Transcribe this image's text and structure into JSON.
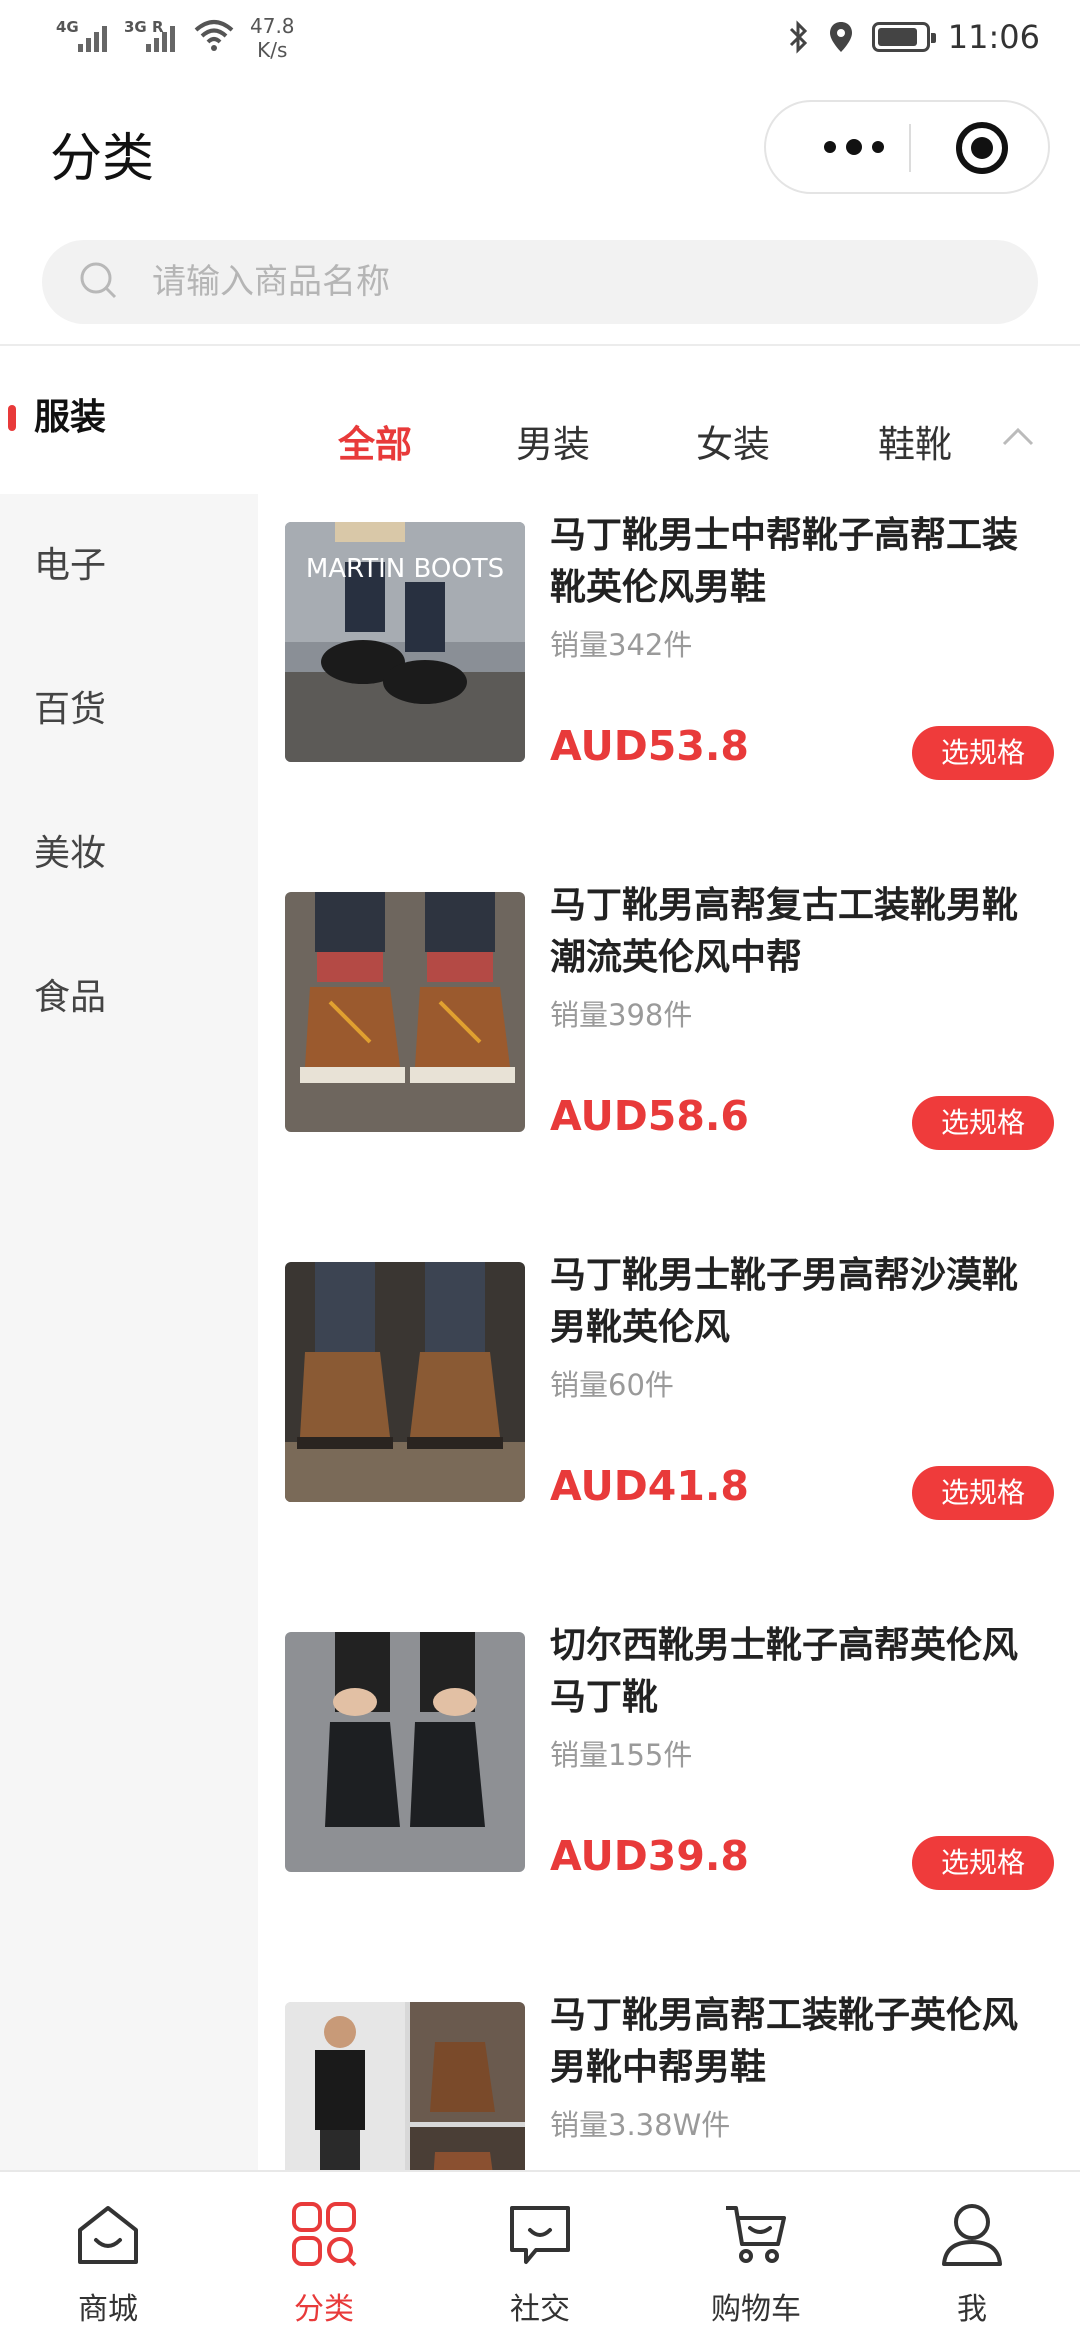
{
  "status_bar": {
    "net1": "4G",
    "net2": "3G R",
    "speed_value": "47.8",
    "speed_unit": "K/s",
    "time": "11:06",
    "battery_level": 0.85
  },
  "header": {
    "title": "分类"
  },
  "search": {
    "placeholder": "请输入商品名称",
    "value": ""
  },
  "sidebar": {
    "items": [
      {
        "label": "服装",
        "active": true
      },
      {
        "label": "电子",
        "active": false
      },
      {
        "label": "百货",
        "active": false
      },
      {
        "label": "美妆",
        "active": false
      },
      {
        "label": "食品",
        "active": false
      }
    ]
  },
  "tabs": {
    "items": [
      {
        "label": "全部",
        "active": true
      },
      {
        "label": "男装",
        "active": false
      },
      {
        "label": "女装",
        "active": false
      },
      {
        "label": "鞋靴",
        "active": false
      }
    ]
  },
  "products": [
    {
      "name": "马丁靴男士中帮靴子高帮工装靴英伦风男鞋",
      "sales": "销量342件",
      "price": "AUD53.8",
      "button": "选规格",
      "image_text": "MARTIN BOOTS"
    },
    {
      "name": "马丁靴男高帮复古工装靴男靴潮流英伦风中帮",
      "sales": "销量398件",
      "price": "AUD58.6",
      "button": "选规格"
    },
    {
      "name": "马丁靴男士靴子男高帮沙漠靴男靴英伦风",
      "sales": "销量60件",
      "price": "AUD41.8",
      "button": "选规格"
    },
    {
      "name": "切尔西靴男士靴子高帮英伦风马丁靴",
      "sales": "销量155件",
      "price": "AUD39.8",
      "button": "选规格"
    },
    {
      "name": "马丁靴男高帮工装靴子英伦风男靴中帮男鞋",
      "sales": "销量3.38W件",
      "price": "",
      "button": ""
    }
  ],
  "tabbar": {
    "items": [
      {
        "label": "商城",
        "icon": "home-icon",
        "active": false
      },
      {
        "label": "分类",
        "icon": "category-icon",
        "active": true
      },
      {
        "label": "社交",
        "icon": "chat-icon",
        "active": false
      },
      {
        "label": "购物车",
        "icon": "cart-icon",
        "active": false
      },
      {
        "label": "我",
        "icon": "profile-icon",
        "active": false
      }
    ]
  },
  "colors": {
    "accent": "#e83a3a",
    "sidebar_bg": "#f6f6f6"
  }
}
